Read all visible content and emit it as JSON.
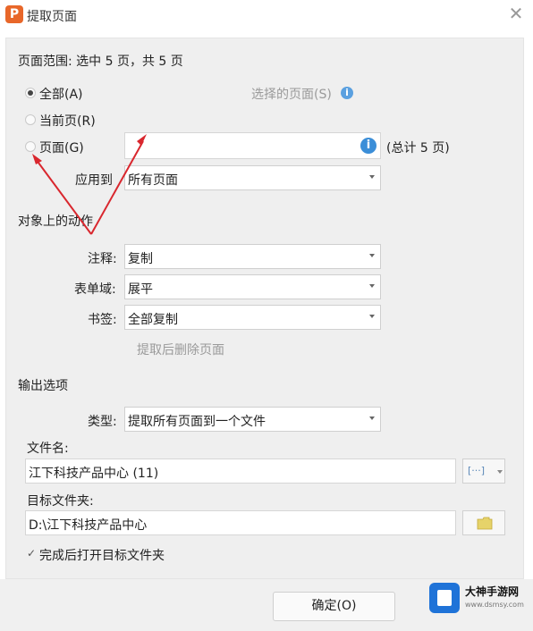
{
  "window": {
    "title": "提取页面",
    "app_icon_letter": "P",
    "close_glyph": "✕"
  },
  "page_range": {
    "summary": "页面范围: 选中 5 页，共 5 页",
    "options": [
      {
        "label": "全部(A)",
        "checked": true
      },
      {
        "label": "当前页(R)",
        "checked": false
      },
      {
        "label": "页面(G)",
        "checked": false
      }
    ],
    "selected_pages_label": "选择的页面(S)",
    "pages_input_value": "",
    "total_label": "(总计 5 页)",
    "apply_to_label": "应用到",
    "apply_to_value": "所有页面"
  },
  "actions": {
    "section_title": "对象上的动作",
    "annotation_label": "注释:",
    "annotation_value": "复制",
    "form_label": "表单域:",
    "form_value": "展平",
    "bookmark_label": "书签:",
    "bookmark_value": "全部复制",
    "delete_after_label": "提取后删除页面"
  },
  "output": {
    "section_title": "输出选项",
    "type_label": "类型:",
    "type_value": "提取所有页面到一个文件",
    "filename_label": "文件名:",
    "filename_value": "江下科技产品中心 (11)",
    "filename_btn": "[···]",
    "folder_label": "目标文件夹:",
    "folder_value": "D:\\江下科技产品中心",
    "open_after_label": "完成后打开目标文件夹",
    "open_after_checked": true
  },
  "footer": {
    "ok_label": "确定(O)"
  },
  "watermark": {
    "brand": "大神手游网",
    "url": "www.dsmsy.com"
  },
  "colors": {
    "accent": "#3b8ed8",
    "annotation_arrow": "#d9272e",
    "app_icon": "#e8672a"
  }
}
